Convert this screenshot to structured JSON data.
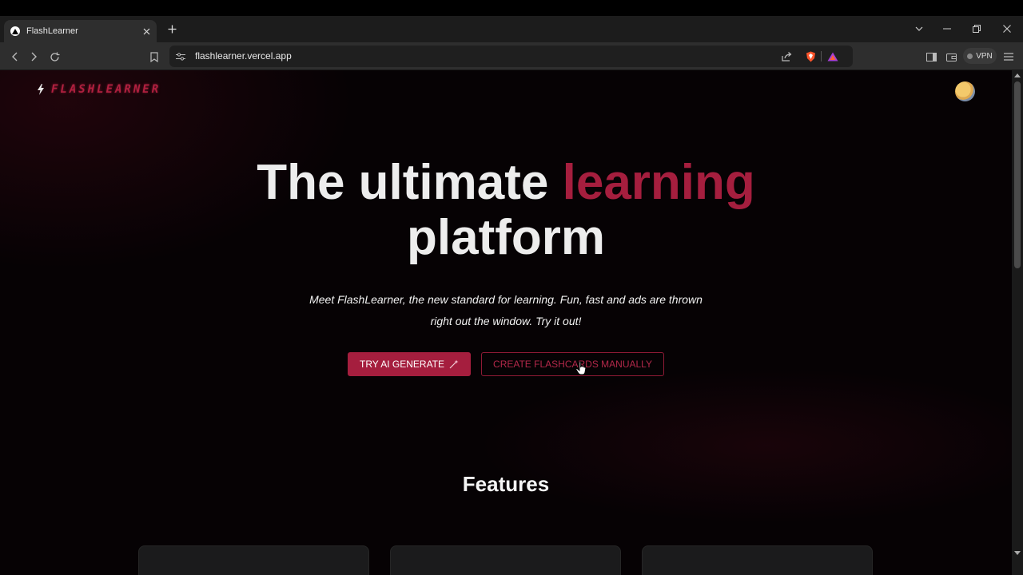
{
  "browser": {
    "tab_title": "FlashLearner",
    "url": "flashlearner.vercel.app",
    "vpn_label": "VPN"
  },
  "site": {
    "logo_text": "FLASHLEARNER",
    "hero": {
      "title_part1": "The ultimate ",
      "title_accent": "learning",
      "title_part2": "platform",
      "subtitle_line1": "Meet FlashLearner, the new standard for learning. Fun, fast and ads are thrown",
      "subtitle_line2": "right out the window. Try it out!"
    },
    "buttons": {
      "ai_generate": "TRY AI GENERATE",
      "create_manual": "CREATE FLASHCARDS MANUALLY"
    },
    "features_title": "Features"
  },
  "colors": {
    "accent": "#a51e3e",
    "background": "#060204",
    "tab_bar": "#1c1c1c",
    "toolbar": "#2e2e2e"
  },
  "icons": [
    "vercel-icon",
    "close-icon",
    "plus-icon",
    "chevron-down-icon",
    "minimize-icon",
    "restore-icon",
    "back-icon",
    "forward-icon",
    "reload-icon",
    "bookmark-icon",
    "site-settings-icon",
    "share-icon",
    "brave-shield-icon",
    "brave-rewards-icon",
    "sidebar-icon",
    "wallet-icon",
    "menu-icon",
    "bolt-icon",
    "sparkle-icon",
    "hand-cursor-icon"
  ]
}
